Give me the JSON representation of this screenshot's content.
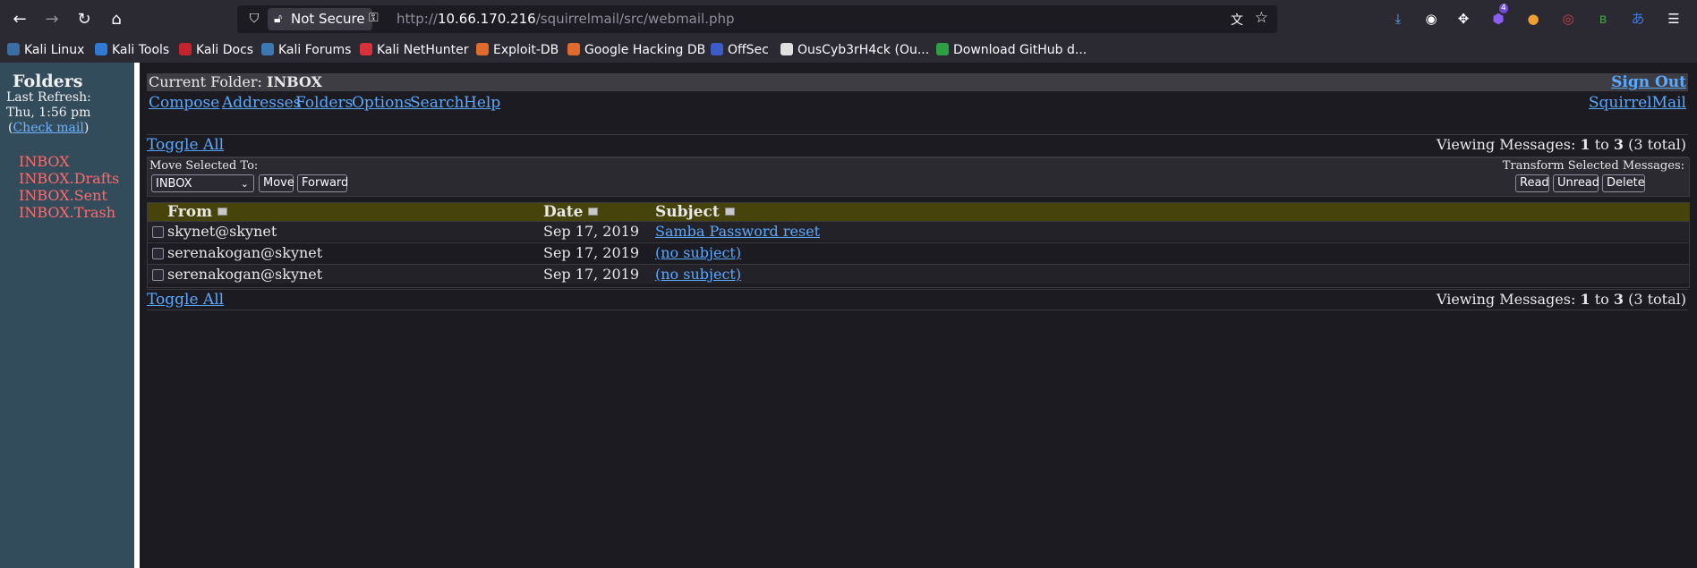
{
  "browser": {
    "url_protocol": "http://",
    "url_host": "10.66.170.216",
    "url_path": "/squirrelmail/src/webmail.php",
    "security_label": "Not Secure",
    "extension_badge": "4",
    "bookmarks": [
      {
        "label": "Kali Linux",
        "color": "#3a6ea5"
      },
      {
        "label": "Kali Tools",
        "color": "#2f7bd3"
      },
      {
        "label": "Kali Docs",
        "color": "#c3242d"
      },
      {
        "label": "Kali Forums",
        "color": "#3c78b4"
      },
      {
        "label": "Kali NetHunter",
        "color": "#d9313a"
      },
      {
        "label": "Exploit-DB",
        "color": "#e06b2d"
      },
      {
        "label": "Google Hacking DB",
        "color": "#e06b2d"
      },
      {
        "label": "OffSec",
        "color": "#3d5cc9"
      },
      {
        "label": "OusCyb3rH4ck (Ou...",
        "color": "#e0e0e0"
      },
      {
        "label": "Download GitHub d...",
        "color": "#2ea043"
      }
    ]
  },
  "left": {
    "title": "Folders",
    "last_refresh_label": "Last Refresh:",
    "last_refresh_time": "Thu, 1:56 pm",
    "check_mail_open": "(",
    "check_mail_label": "Check mail",
    "check_mail_close": ")",
    "folders": [
      "INBOX",
      "INBOX.Drafts",
      "INBOX.Sent",
      "INBOX.Trash"
    ]
  },
  "main": {
    "current_folder_label": "Current Folder:",
    "current_folder": "INBOX",
    "sign_out": "Sign Out",
    "menu": [
      "Compose",
      "Addresses",
      "Folders",
      "Options",
      "Search",
      "Help"
    ],
    "brand_link": "SquirrelMail",
    "toggle_all": "Toggle All",
    "viewing": {
      "prefix": "Viewing Messages:",
      "from": "1",
      "to_word": "to",
      "to": "3",
      "total": "(3 total)"
    },
    "move_label": "Move Selected To:",
    "move_select_value": "INBOX",
    "move_button": "Move",
    "forward_button": "Forward",
    "transform_label": "Transform Selected Messages:",
    "read_button": "Read",
    "unread_button": "Unread",
    "delete_button": "Delete",
    "columns": {
      "from": "From",
      "date": "Date",
      "subject": "Subject"
    },
    "messages": [
      {
        "from": "skynet@skynet",
        "date": "Sep 17, 2019",
        "subject": "Samba Password reset"
      },
      {
        "from": "serenakogan@skynet",
        "date": "Sep 17, 2019",
        "subject": "(no subject)"
      },
      {
        "from": "serenakogan@skynet",
        "date": "Sep 17, 2019",
        "subject": "(no subject)"
      }
    ]
  },
  "colors": {
    "link": "#5aa9ff",
    "folder": "#ff6b6b",
    "sidebar": "#334c5c",
    "header_row": "#46440a"
  }
}
